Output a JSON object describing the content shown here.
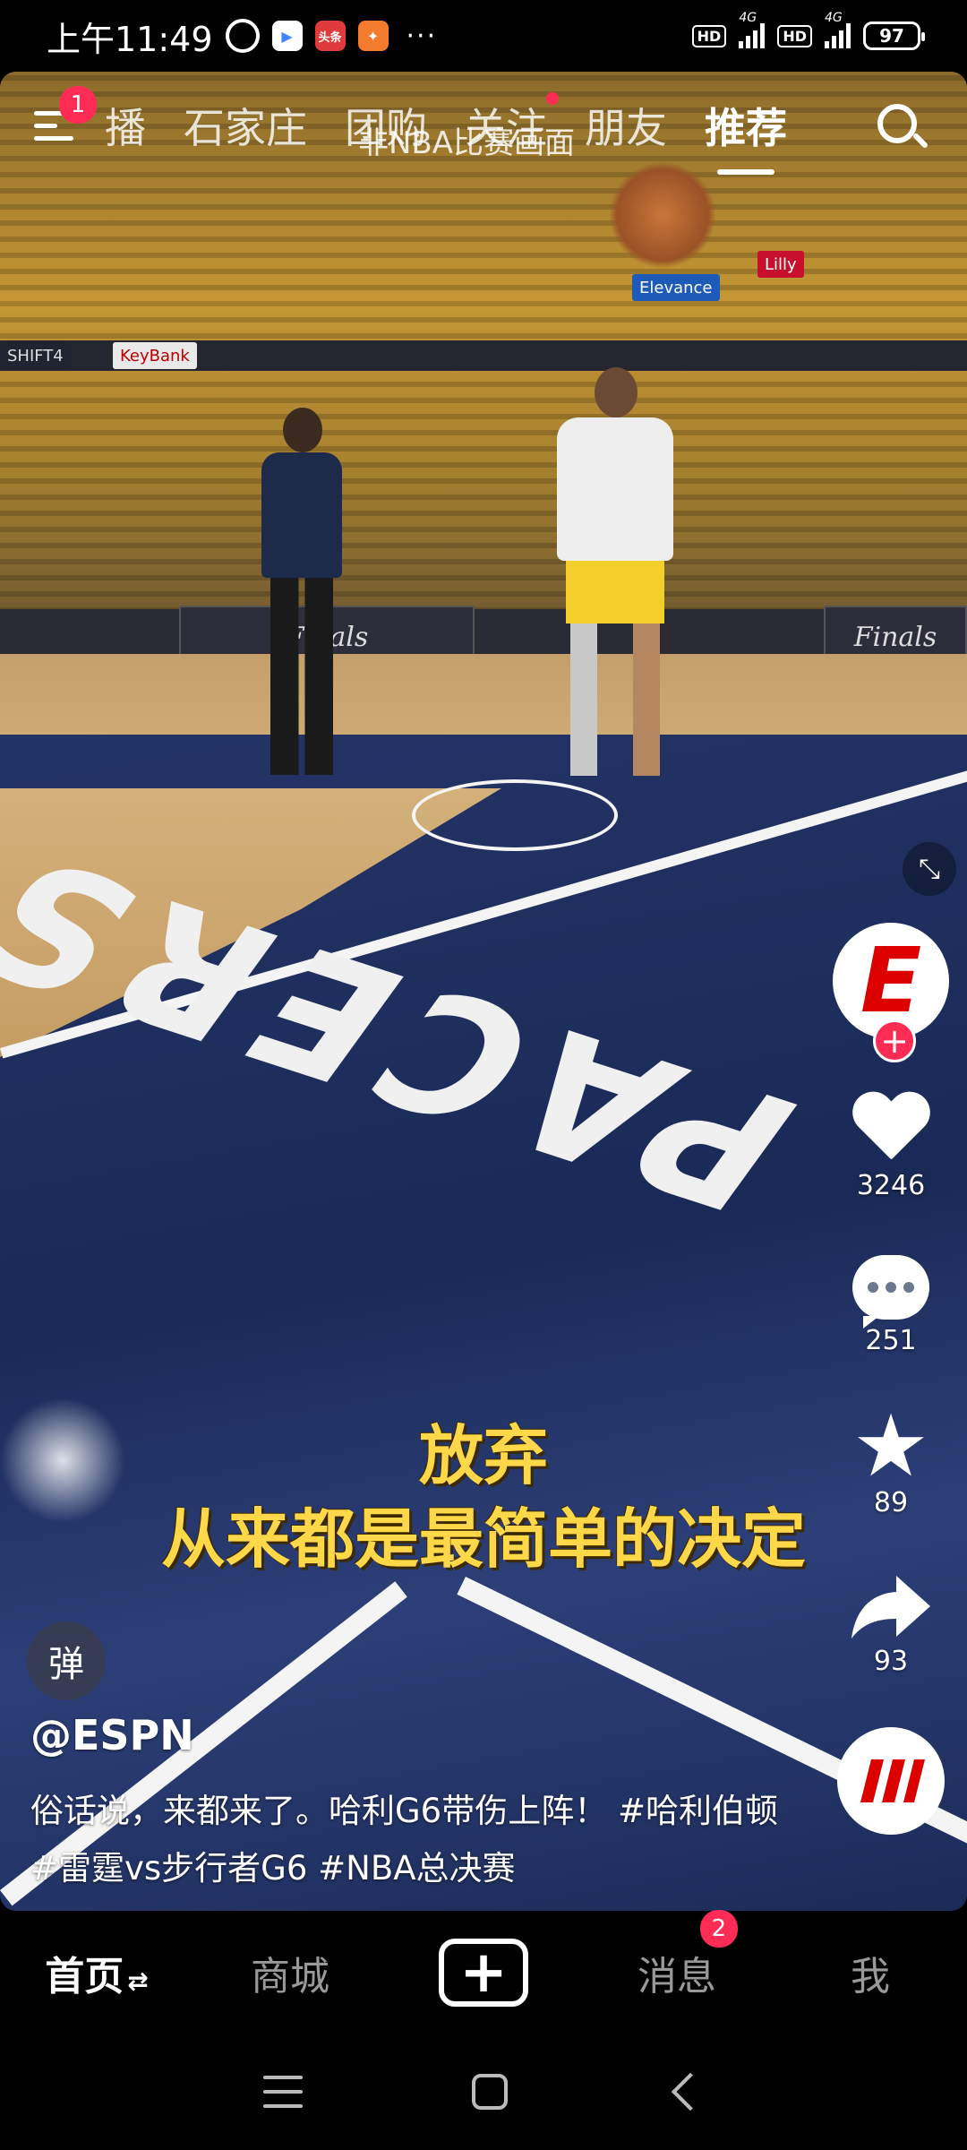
{
  "status_bar": {
    "time": "上午11:49",
    "app_icons": [
      "alarm-icon",
      "google-play-icon",
      "toutiao-icon",
      "app-icon"
    ],
    "toutiao_text": "头条",
    "more": "···",
    "hd1": "HD",
    "net1": "4G",
    "hd2": "HD",
    "net2": "4G",
    "battery": "97"
  },
  "top_nav": {
    "menu_badge": "1",
    "tabs": [
      {
        "label": "播",
        "active": false
      },
      {
        "label": "石家庄",
        "active": false
      },
      {
        "label": "团购",
        "active": false
      },
      {
        "label": "关注",
        "active": false,
        "dot": true
      },
      {
        "label": "朋友",
        "active": false
      },
      {
        "label": "推荐",
        "active": true
      }
    ],
    "overlay_hint": "非NBA比赛画面"
  },
  "video": {
    "court_text": "PACERS",
    "finals_board": "Finals",
    "subtitle_line1": "放弃",
    "subtitle_line2": "从来都是最简单的决定"
  },
  "rail": {
    "like_count": "3246",
    "comment_count": "251",
    "favorite_count": "89",
    "share_count": "93"
  },
  "post": {
    "danmu_label": "弹",
    "author": "@ESPN",
    "description": "俗话说，来都来了。哈利G6带伤上阵！ #哈利伯顿 #雷霆vs步行者G6 #NBA总决赛"
  },
  "tab_bar": {
    "home": "首页",
    "home_swap": "⇄",
    "mall": "商城",
    "create": "+",
    "messages": "消息",
    "messages_badge": "2",
    "me": "我"
  },
  "colors": {
    "accent": "#fe2c55",
    "subtitle": "#ffd84a",
    "espn_red": "#dd0000"
  }
}
